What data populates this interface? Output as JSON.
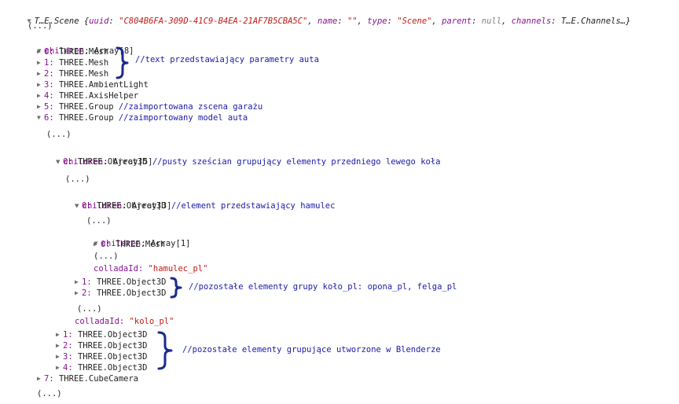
{
  "header": {
    "prefix": "T…E.Scene {",
    "uuid_key": "uuid",
    "uuid_value": "\"C804B6FA-309D-41C9-B4EA-21AF7B5CBA5C\"",
    "name_key": "name",
    "name_value": "\"\"",
    "type_key": "type",
    "type_value": "\"Scene\"",
    "parent_key": "parent",
    "parent_value": "null",
    "channels_key": "channels",
    "channels_value": "T…E.Channels…}"
  },
  "ellipsis": "(...)",
  "root_children": {
    "key": "children",
    "label": "Array[8]",
    "items": [
      {
        "index": "0:",
        "label": "THREE.Mesh"
      },
      {
        "index": "1:",
        "label": "THREE.Mesh"
      },
      {
        "index": "2:",
        "label": "THREE.Mesh"
      },
      {
        "index": "3:",
        "label": "THREE.AmbientLight"
      },
      {
        "index": "4:",
        "label": "THREE.AxisHelper"
      },
      {
        "index": "5:",
        "label": "THREE.Group",
        "comment": "//zaimportowana zscena garażu"
      },
      {
        "index": "6:",
        "label": "THREE.Group",
        "comment": "//zaimportowany model auta"
      },
      {
        "index": "7:",
        "label": "THREE.CubeCamera"
      }
    ]
  },
  "car_children": {
    "key": "children",
    "label": "Array[5]",
    "item0": {
      "index": "0:",
      "label": "THREE.Object3D",
      "comment": "//pusty sześcian grupujący elementy przedniego lewego koła"
    },
    "rest": [
      {
        "index": "1:",
        "label": "THREE.Object3D"
      },
      {
        "index": "2:",
        "label": "THREE.Object3D"
      },
      {
        "index": "3:",
        "label": "THREE.Object3D"
      },
      {
        "index": "4:",
        "label": "THREE.Object3D"
      }
    ]
  },
  "wheel_children": {
    "key": "children",
    "label": "Array[3]",
    "item0": {
      "index": "0:",
      "label": "THREE.Object3D",
      "comment": "//element przedstawiający hamulec"
    },
    "rest": [
      {
        "index": "1:",
        "label": "THREE.Object3D"
      },
      {
        "index": "2:",
        "label": "THREE.Object3D"
      }
    ]
  },
  "brake_children": {
    "key": "children",
    "label": "Array[1]",
    "item0": {
      "index": "0:",
      "label": "THREE.Mesh"
    }
  },
  "brake_collada": {
    "key": "colladaId:",
    "value": "\"hamulec_pl\""
  },
  "wheel_collada": {
    "key": "colladaId:",
    "value": "\"kolo_pl\""
  },
  "annotations": {
    "meshes": "//text przedstawiający parametry auta",
    "wheel_rest": "//pozostałe elementy grupy koło_pl: opona_pl, felga_pl",
    "car_rest": "//pozostałe elementy grupujące utworzone w Blenderze"
  },
  "colors": {
    "key": "#881391",
    "string": "#c41a16",
    "null": "#808080",
    "comment": "#1a1aa6",
    "brace": "#1b2a8c"
  }
}
